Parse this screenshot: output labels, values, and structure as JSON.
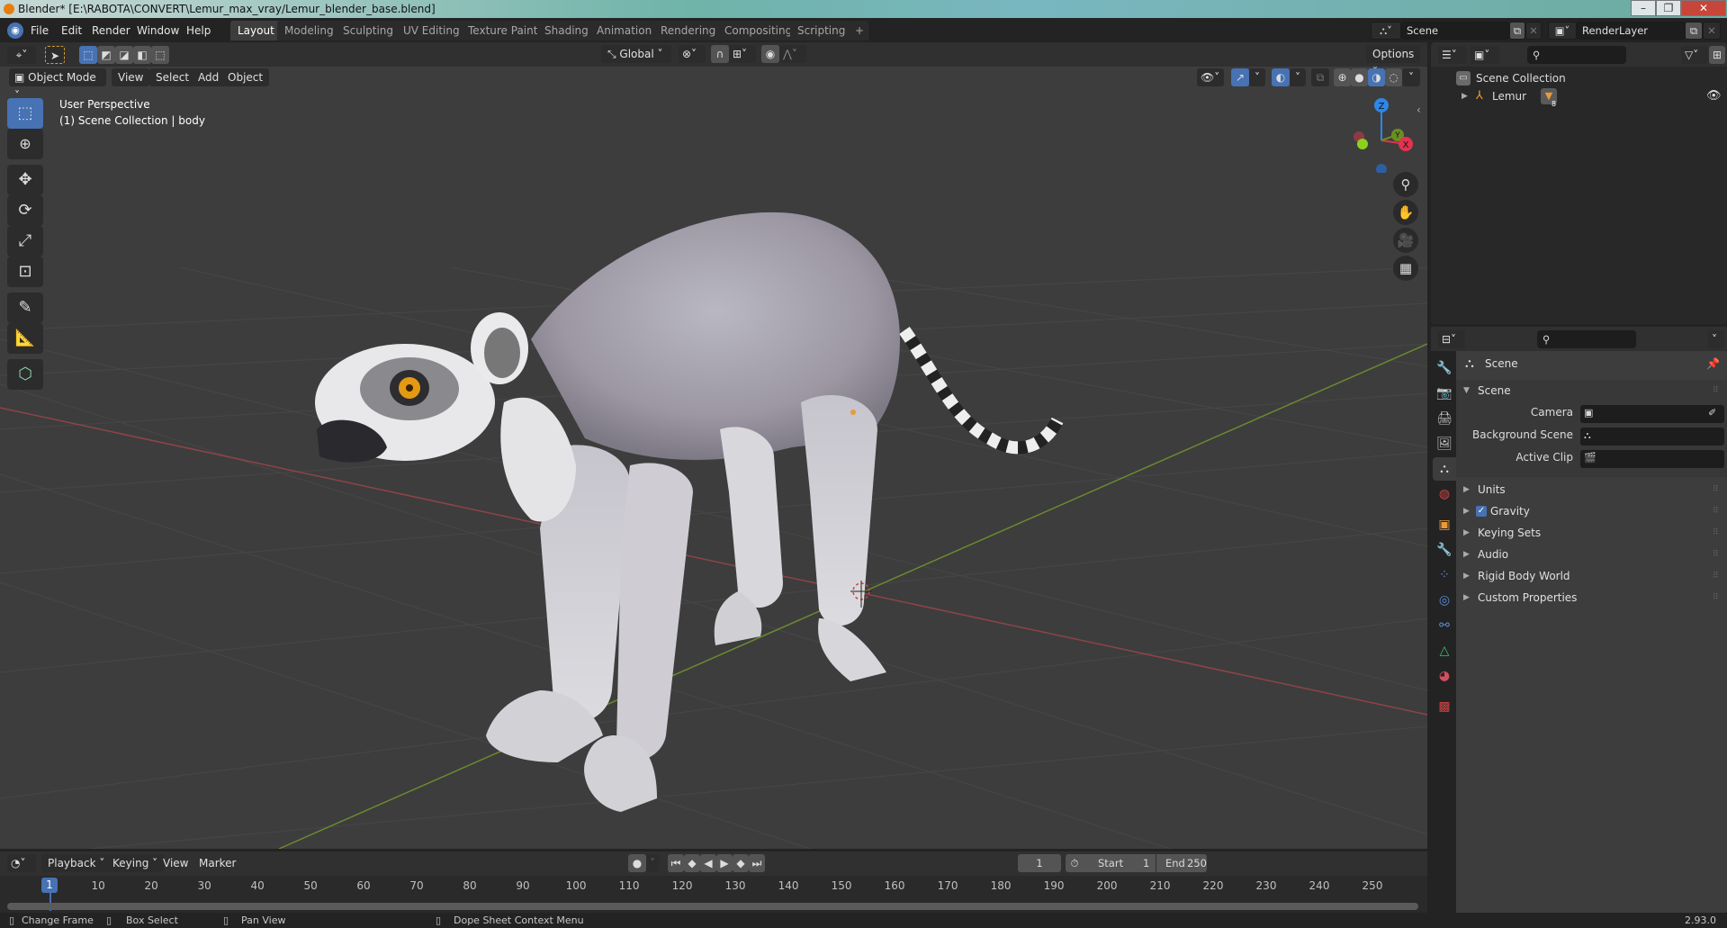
{
  "window": {
    "title": "Blender* [E:\\RABOTA\\CONVERT\\Lemur_max_vray/Lemur_blender_base.blend]",
    "controls": [
      "minimize",
      "maximize",
      "close"
    ]
  },
  "menu": [
    "File",
    "Edit",
    "Render",
    "Window",
    "Help"
  ],
  "workspaces": [
    {
      "label": "Layout",
      "active": true
    },
    {
      "label": "Modeling"
    },
    {
      "label": "Sculpting"
    },
    {
      "label": "UV Editing"
    },
    {
      "label": "Texture Paint"
    },
    {
      "label": "Shading"
    },
    {
      "label": "Animation"
    },
    {
      "label": "Rendering"
    },
    {
      "label": "Compositing"
    },
    {
      "label": "Scripting"
    }
  ],
  "add_workspace": "+",
  "scene_selector": {
    "value": "Scene"
  },
  "view_layer_selector": {
    "value": "RenderLayer"
  },
  "tool_header": {
    "transform_orientation": "Global",
    "options_label": "Options"
  },
  "viewport_header": {
    "mode": "Object Mode",
    "menus": [
      "View",
      "Select",
      "Add",
      "Object"
    ]
  },
  "viewport": {
    "perspective_label": "User Perspective",
    "collection_label": "(1) Scene Collection | body",
    "gizmo": {
      "z": "Z",
      "y": "Y",
      "x": "X"
    },
    "shading_active": "solid",
    "colors": {
      "x_axis": "#a8434e",
      "y_axis": "#6b8e23",
      "z_axis": "#2f86e8",
      "accent": "#4772b3"
    }
  },
  "tools": [
    "select-box",
    "cursor",
    "move",
    "rotate",
    "scale",
    "transform",
    "annotate",
    "measure",
    "add-cube"
  ],
  "outliner": {
    "root": "Scene Collection",
    "items": [
      {
        "label": "Lemur",
        "modifier_count": "8",
        "visible": true
      }
    ]
  },
  "properties": {
    "context": "Scene",
    "panel_title": "Scene",
    "fields": [
      {
        "label": "Camera",
        "value": ""
      },
      {
        "label": "Background Scene",
        "value": ""
      },
      {
        "label": "Active Clip",
        "value": ""
      }
    ],
    "collapsed_panels": [
      {
        "label": "Units"
      },
      {
        "label": "Gravity",
        "checked": true
      },
      {
        "label": "Keying Sets"
      },
      {
        "label": "Audio"
      },
      {
        "label": "Rigid Body World"
      },
      {
        "label": "Custom Properties"
      }
    ],
    "tabs": [
      "tool",
      "render",
      "output",
      "view-layer",
      "scene",
      "world",
      "object",
      "modifiers",
      "particles",
      "physics",
      "constraints",
      "data",
      "material",
      "texture"
    ]
  },
  "timeline": {
    "menus": [
      "Playback",
      "Keying",
      "View",
      "Marker"
    ],
    "current_frame": "1",
    "start_label": "Start",
    "start": "1",
    "end_label": "End",
    "end": "250",
    "ticks": [
      "1",
      "10",
      "20",
      "30",
      "40",
      "50",
      "60",
      "70",
      "80",
      "90",
      "100",
      "110",
      "120",
      "130",
      "140",
      "150",
      "160",
      "170",
      "180",
      "190",
      "200",
      "210",
      "220",
      "230",
      "240",
      "250"
    ]
  },
  "statusbar": {
    "hints": [
      "Change Frame",
      "Box Select",
      "Pan View",
      "Dope Sheet Context Menu"
    ],
    "version": "2.93.0"
  }
}
